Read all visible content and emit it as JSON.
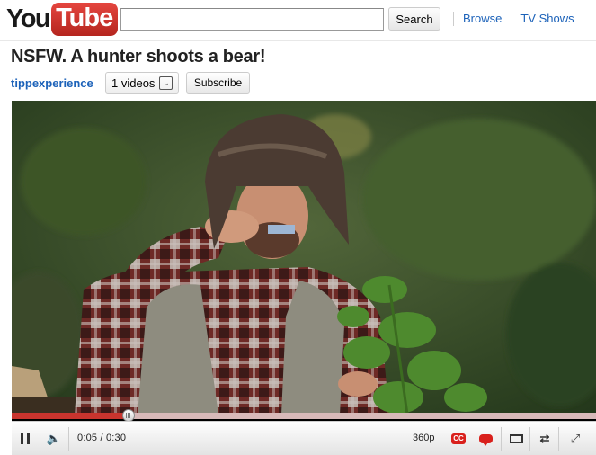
{
  "header": {
    "logo_you": "You",
    "logo_tube": "Tube",
    "search_value": "",
    "search_placeholder": "",
    "search_button": "Search",
    "nav": [
      "Browse",
      "TV Shows"
    ]
  },
  "video": {
    "title": "NSFW. A hunter shoots a bear!",
    "channel": "tippexperience",
    "videos_count": "1 videos",
    "subscribe": "Subscribe"
  },
  "player": {
    "current_time": "0:05",
    "duration": "0:30",
    "time_display": "0:05 / 0:30",
    "progress_fraction": 0.2,
    "quality": "360p",
    "cc_label": "CC",
    "colors": {
      "progress_played": "#c9342e",
      "progress_track": "#d8b9b9",
      "cc_badge": "#d9201c"
    }
  }
}
